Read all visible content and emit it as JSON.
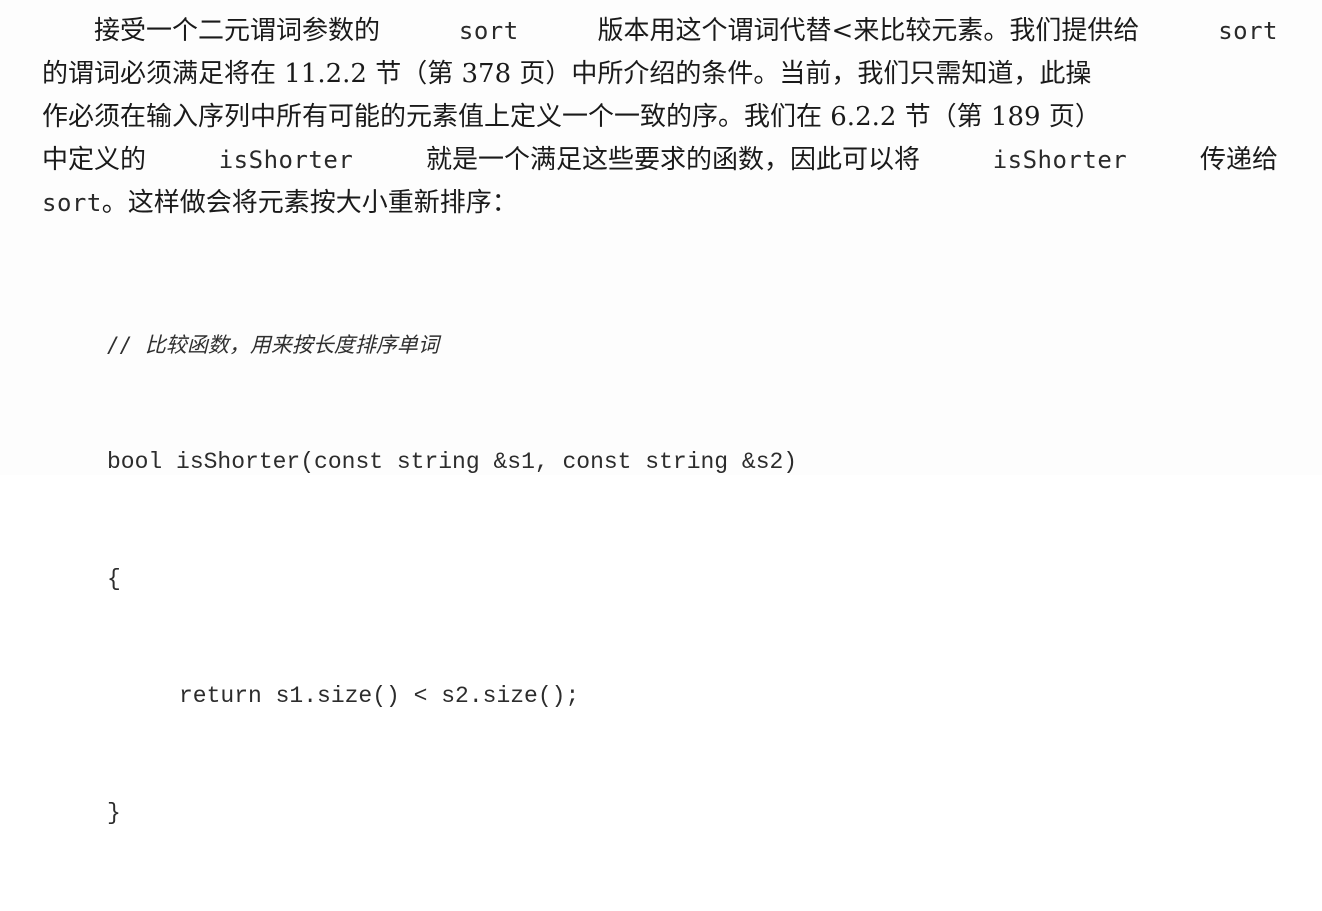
{
  "prose": {
    "lines": [
      [
        "接受一个二元谓词参数的 ",
        "sort",
        " 版本用这个谓词代替<来比较元素。我们提供给 ",
        "sort"
      ],
      [
        "的谓词必须满足将在 11.2.2 节（第 378 页）中所介绍的条件。当前，我们只需知道，此操"
      ],
      [
        "作必须在输入序列中所有可能的元素值上定义一个一致的序。我们在 6.2.2 节（第 189 页）"
      ],
      [
        "中定义的 ",
        "isShorter",
        " 就是一个满足这些要求的函数，因此可以将 ",
        "isShorter",
        " 传递给"
      ],
      [
        "sort",
        "。这样做会将元素按大小重新排序："
      ]
    ]
  },
  "code": {
    "comment": "// 比较函数，用来按长度排序单词",
    "line1": "bool isShorter(const string &s1, const string &s2)",
    "open_brace": "{",
    "body": "return s1.size() < s2.size();",
    "close_brace": "}"
  }
}
